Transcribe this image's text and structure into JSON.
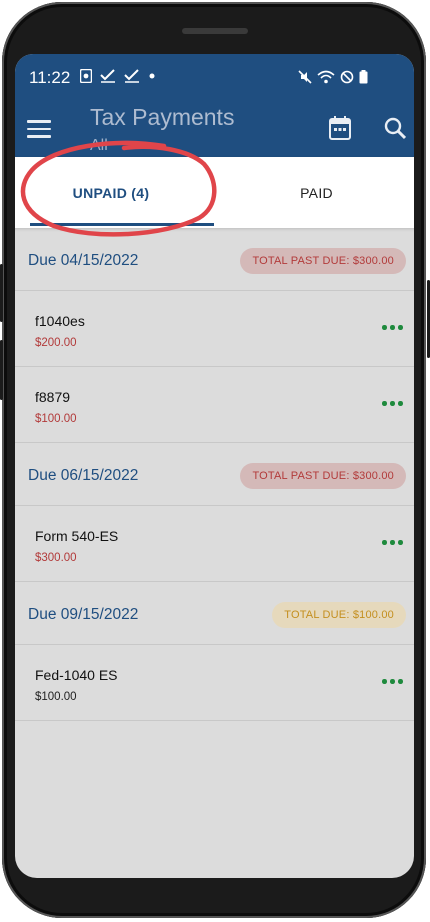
{
  "status_bar": {
    "time": "11:22"
  },
  "app_bar": {
    "title": "Tax Payments",
    "subtitle": "All",
    "icons": [
      "menu-icon",
      "calendar-icon",
      "search-icon"
    ]
  },
  "tabs": [
    {
      "label": "UNPAID (4)",
      "selected": true
    },
    {
      "label": "PAID",
      "selected": false
    }
  ],
  "sections": [
    {
      "due_date": "Due 04/15/2022",
      "badge": "TOTAL PAST DUE: $300.00",
      "badge_kind": "past",
      "items": [
        {
          "name": "f1040es",
          "amount": "$200.00",
          "amount_color": "red"
        },
        {
          "name": "f8879",
          "amount": "$100.00",
          "amount_color": "red"
        }
      ]
    },
    {
      "due_date": "Due 06/15/2022",
      "badge": "TOTAL PAST DUE: $300.00",
      "badge_kind": "past",
      "items": [
        {
          "name": "Form 540-ES",
          "amount": "$300.00",
          "amount_color": "red"
        }
      ]
    },
    {
      "due_date": "Due 09/15/2022",
      "badge": "TOTAL DUE: $100.00",
      "badge_kind": "total",
      "items": [
        {
          "name": "Fed-1040 ES",
          "amount": "$100.00",
          "amount_color": "dark"
        }
      ]
    }
  ],
  "colors": {
    "app_bar": "#1f4e80",
    "past_due": "#b23a3a",
    "due": "#c48f1f",
    "more": "#1e8a3d",
    "annotation": "#e0454a"
  }
}
